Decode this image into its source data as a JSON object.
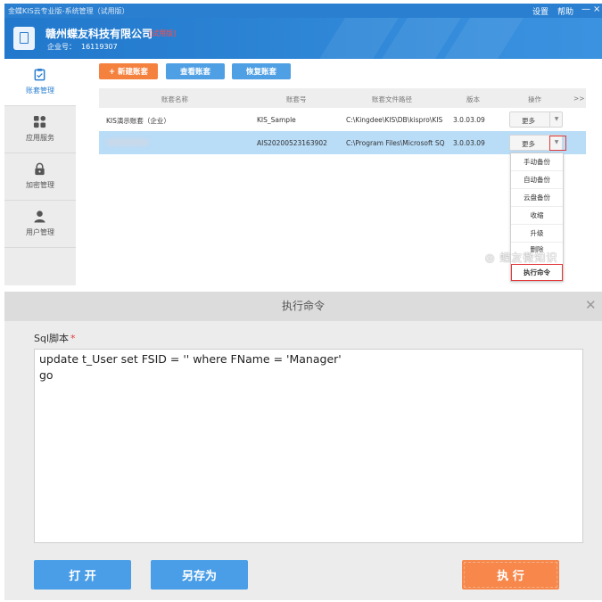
{
  "window": {
    "title": "金蝶KIS云专业版-系统管理（试用版）",
    "settings": "设置",
    "help": "帮助",
    "minimize": "—",
    "close": "×"
  },
  "header": {
    "company": "赣州蝶友科技有限公司",
    "trial_tag": "[试用版]",
    "account_no_label": "企业号：",
    "account_no": "16119307"
  },
  "sidebar": {
    "items": [
      {
        "label": "账套管理",
        "icon": "account-set-icon",
        "active": true
      },
      {
        "label": "应用服务",
        "icon": "apps-grid-icon",
        "active": false
      },
      {
        "label": "加密管理",
        "icon": "lock-icon",
        "active": false
      },
      {
        "label": "用户管理",
        "icon": "user-icon",
        "active": false
      }
    ]
  },
  "toolbar": {
    "new": "+ 新建账套",
    "view": "查看账套",
    "restore": "恢复账套"
  },
  "table": {
    "columns": [
      "账套名称",
      "账套号",
      "账套文件路径",
      "版本",
      "操作",
      ">>"
    ],
    "rows": [
      {
        "name": "KIS演示账套（企业）",
        "code": "KIS_Sample",
        "path": "C:\\Kingdee\\KIS\\DB\\kispro\\KIS",
        "version": "3.0.03.09",
        "action": "更多"
      },
      {
        "name": "",
        "code": "AIS20200523163902",
        "path": "C:\\Program Files\\Microsoft SQ",
        "version": "3.0.03.09",
        "action": "更多"
      }
    ]
  },
  "dropdown": {
    "items": [
      "手动备份",
      "自动备份",
      "云盘备份",
      "收缩",
      "升级",
      "删除"
    ],
    "highlighted": "执行命令"
  },
  "watermark": "蝶友微知识",
  "dialog": {
    "title": "执行命令",
    "sql_label": "Sql脚本",
    "required_mark": "*",
    "sql_lines": [
      "update t_User set FSID = '' where FName = 'Manager'",
      "go"
    ],
    "open_button": "打 开",
    "save_as_button": "另存为",
    "execute_button": "执 行"
  },
  "colors": {
    "brand_blue": "#2a7fd0",
    "accent_orange": "#f5813f",
    "selected_row": "#b9dcf7",
    "highlight_red": "#e23a3a"
  }
}
